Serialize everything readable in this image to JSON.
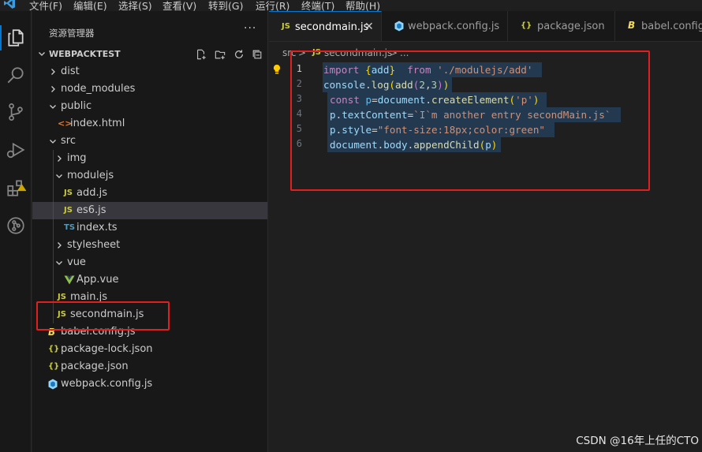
{
  "menu": {
    "items": [
      "文件(F)",
      "编辑(E)",
      "选择(S)",
      "查看(V)",
      "转到(G)",
      "运行(R)",
      "终端(T)",
      "帮助(H)"
    ]
  },
  "activitybar": {
    "icons": [
      "files-icon",
      "search-icon",
      "source-control-icon",
      "run-debug-icon",
      "extensions-icon",
      "gitlens-icon"
    ]
  },
  "sidebar": {
    "title": "资源管理器",
    "more": "···",
    "section": "WEBPACKTEST",
    "tree": [
      {
        "label": "dist",
        "type": "folder",
        "expanded": false,
        "depth": 0
      },
      {
        "label": "node_modules",
        "type": "folder",
        "expanded": false,
        "depth": 0
      },
      {
        "label": "public",
        "type": "folder",
        "expanded": true,
        "depth": 0
      },
      {
        "label": "index.html",
        "type": "html",
        "depth": 1
      },
      {
        "label": "src",
        "type": "folder",
        "expanded": true,
        "depth": 0
      },
      {
        "label": "img",
        "type": "folder",
        "expanded": false,
        "depth": 1
      },
      {
        "label": "modulejs",
        "type": "folder",
        "expanded": true,
        "depth": 1
      },
      {
        "label": "add.js",
        "type": "js",
        "depth": 2
      },
      {
        "label": "es6.js",
        "type": "js",
        "depth": 2,
        "selected": true
      },
      {
        "label": "index.ts",
        "type": "ts",
        "depth": 2
      },
      {
        "label": "stylesheet",
        "type": "folder",
        "expanded": false,
        "depth": 1
      },
      {
        "label": "vue",
        "type": "folder",
        "expanded": true,
        "depth": 1
      },
      {
        "label": "App.vue",
        "type": "vue",
        "depth": 2
      },
      {
        "label": "main.js",
        "type": "js",
        "depth": 1
      },
      {
        "label": "secondmain.js",
        "type": "js",
        "depth": 1
      },
      {
        "label": "babel.config.js",
        "type": "babel",
        "depth": 0
      },
      {
        "label": "package-lock.json",
        "type": "json",
        "depth": 0
      },
      {
        "label": "package.json",
        "type": "json",
        "depth": 0
      },
      {
        "label": "webpack.config.js",
        "type": "webpack",
        "depth": 0
      }
    ]
  },
  "icons": {
    "js": "JS",
    "ts": "TS",
    "json": "{}",
    "html": "<>",
    "babel": "B",
    "vue": "V",
    "close": "✕"
  },
  "colors": {
    "js": "#cbcb41",
    "ts": "#519aba",
    "json": "#cbcb41",
    "html": "#e37933",
    "babel": "#f5da55",
    "vue": "#8dc149",
    "webpack": "#8ed6fb",
    "accent": "#0078d4",
    "annotation": "#e02020"
  },
  "tabs": [
    {
      "label": "secondmain.js",
      "icon": "js",
      "active": true,
      "close": "✕"
    },
    {
      "label": "webpack.config.js",
      "icon": "webpack",
      "active": false
    },
    {
      "label": "package.json",
      "icon": "json",
      "active": false
    },
    {
      "label": "babel.config.js",
      "icon": "babel",
      "active": false
    }
  ],
  "breadcrumb": {
    "folder": "src",
    "sep": ">",
    "file": "secondmain.js",
    "tail": "..."
  },
  "code": {
    "line_numbers": [
      "1",
      "2",
      "3",
      "4",
      "5",
      "6"
    ],
    "current_line": 1
  },
  "watermark": "CSDN @16年上任的CTO"
}
